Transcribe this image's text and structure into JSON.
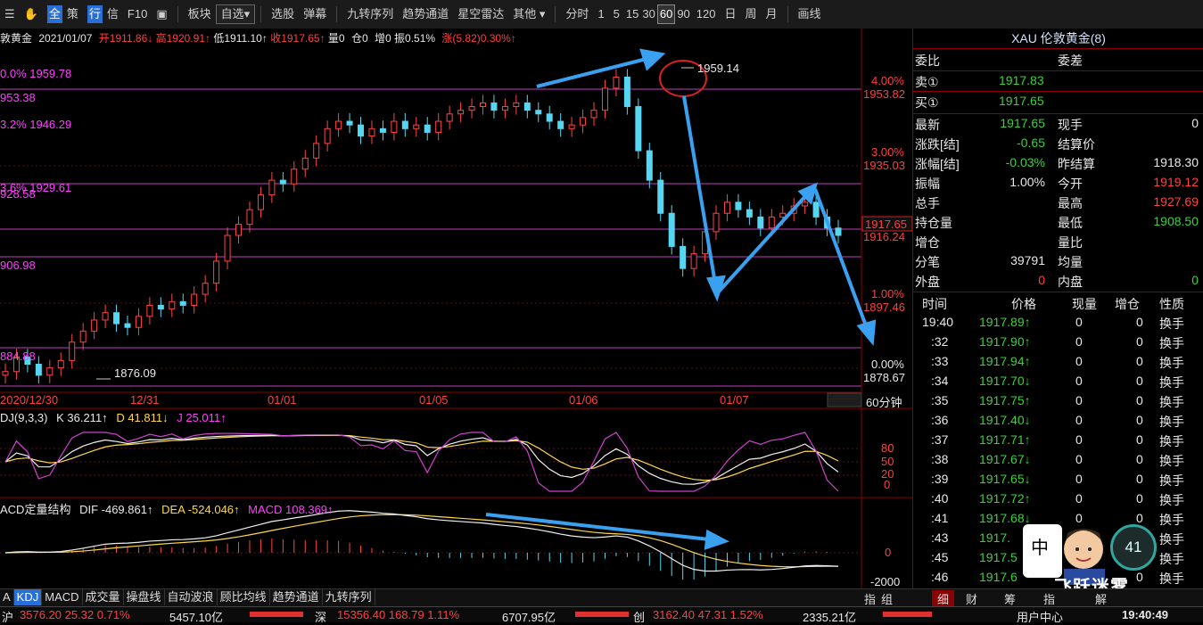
{
  "toolbar": {
    "items": [
      "板块",
      "自选",
      "选股",
      "弹幕",
      "九转序列",
      "趋势通道",
      "星空雷达",
      "其他"
    ],
    "icons_left": [
      "全",
      "策",
      "行",
      "信",
      "F10"
    ],
    "periods": [
      "分时",
      "1",
      "5",
      "15",
      "30",
      "60",
      "90",
      "120",
      "日",
      "周",
      "月"
    ],
    "active_period": "60",
    "draw_label": "画线"
  },
  "info": {
    "symbol": "敦黄金",
    "date": "2021/01/07",
    "open": "开1911.86↓",
    "high": "高1920.91↑",
    "low": "低1911.10↑",
    "close": "收1917.65↑",
    "vol": "量0",
    "pos": "仓0",
    "add": "增0",
    "amp": "振0.51%",
    "chg": "涨(5.82)0.30%↑"
  },
  "chart_data": {
    "type": "candlestick",
    "period": "60分钟",
    "price_axis": [
      "4.00%",
      "1953.82",
      "3.00%",
      "1935.03",
      "1917.65",
      "1916.24",
      "1.00%",
      "1897.46",
      "0.00%",
      "1878.67"
    ],
    "fib_labels": [
      "0.0% 1959.78",
      "953.38",
      "3.2% 1946.29",
      "3.6% 1929.61",
      "928.58",
      "906.98",
      "884.88"
    ],
    "annotations": [
      "1959.14",
      "1876.09"
    ],
    "date_labels": [
      "2020/12/30",
      "12/31",
      "01/01",
      "01/05",
      "01/06",
      "01/07"
    ],
    "kdj": {
      "label": "DJ(9,3,3)",
      "K": "K 36.211↑",
      "D": "D 41.811↓",
      "J": "J 25.011↑",
      "axis": [
        "80",
        "50",
        "20",
        "0"
      ]
    },
    "macd": {
      "label": "ACD定量结构",
      "DIF": "DIF -469.861↑",
      "DEA": "DEA -524.046↑",
      "MACD": "MACD 108.369↑",
      "axis": [
        "0",
        "-2000"
      ]
    },
    "closes": [
      1878,
      1882,
      1880,
      1877,
      1879,
      1881,
      1886,
      1889,
      1892,
      1894,
      1891,
      1890,
      1893,
      1896,
      1895,
      1897,
      1896,
      1899,
      1902,
      1908,
      1915,
      1918,
      1922,
      1926,
      1930,
      1929,
      1933,
      1936,
      1940,
      1944,
      1946,
      1945,
      1942,
      1944,
      1943,
      1946,
      1944,
      1945,
      1943,
      1946,
      1948,
      1949,
      1950,
      1951,
      1949,
      1950,
      1951,
      1949,
      1948,
      1946,
      1944,
      1945,
      1947,
      1949,
      1955,
      1958,
      1950,
      1938,
      1930,
      1921,
      1912,
      1906,
      1910,
      1916,
      1921,
      1924,
      1922,
      1920,
      1917,
      1920,
      1921,
      1923,
      1924,
      1920,
      1917,
      1915
    ]
  },
  "rightpanel": {
    "title": "XAU 伦敦黄金(8)",
    "weibi": "委比",
    "weicha": "委差",
    "sell_label": "卖①",
    "sell_price": "1917.83",
    "buy_label": "买①",
    "buy_price": "1917.65",
    "rows_left": [
      [
        "最新",
        "1917.65"
      ],
      [
        "涨跌[结]",
        "-0.65"
      ],
      [
        "涨幅[结]",
        "-0.03%"
      ],
      [
        "振幅",
        "1.00%"
      ],
      [
        "总手",
        ""
      ],
      [
        "持仓量",
        ""
      ],
      [
        "增仓",
        ""
      ],
      [
        "分笔",
        "39791"
      ],
      [
        "外盘",
        "0"
      ]
    ],
    "rows_right": [
      [
        "现手",
        "0"
      ],
      [
        "结算价",
        ""
      ],
      [
        "昨结算",
        "1918.30"
      ],
      [
        "今开",
        "1919.12"
      ],
      [
        "最高",
        "1927.69"
      ],
      [
        "最低",
        "1908.50"
      ],
      [
        "量比",
        ""
      ],
      [
        "均量",
        ""
      ],
      [
        "内盘",
        "0"
      ]
    ],
    "tick_headers": [
      "时间",
      "价格",
      "现量",
      "增仓",
      "性质"
    ],
    "ticks": [
      [
        "19:40",
        "1917.89↑",
        "0",
        "0",
        "换手"
      ],
      [
        ":32",
        "1917.90↑",
        "0",
        "0",
        "换手"
      ],
      [
        ":33",
        "1917.94↑",
        "0",
        "0",
        "换手"
      ],
      [
        ":34",
        "1917.70↓",
        "0",
        "0",
        "换手"
      ],
      [
        ":35",
        "1917.75↑",
        "0",
        "0",
        "换手"
      ],
      [
        ":36",
        "1917.40↓",
        "0",
        "0",
        "换手"
      ],
      [
        ":37",
        "1917.71↑",
        "0",
        "0",
        "换手"
      ],
      [
        ":38",
        "1917.67↓",
        "0",
        "0",
        "换手"
      ],
      [
        ":39",
        "1917.65↓",
        "0",
        "0",
        "换手"
      ],
      [
        ":40",
        "1917.72↑",
        "0",
        "0",
        "换手"
      ],
      [
        ":41",
        "1917.68↓",
        "0",
        "0",
        "换手"
      ],
      [
        ":43",
        "1917.",
        "0",
        "0",
        "换手"
      ],
      [
        ":45",
        "1917.5",
        "0",
        "0",
        "换手"
      ],
      [
        ":46",
        "1917.6",
        "0",
        "0",
        "换手"
      ]
    ]
  },
  "bottomtabs": [
    "A",
    "KDJ",
    "MACD",
    "成交量",
    "操盘线",
    "自动波浪",
    "顾比均线",
    "趋势通道",
    "九转序列"
  ],
  "bottom_right": [
    "指",
    "组",
    "细",
    "财",
    "筹",
    "指",
    "解"
  ],
  "statusbar": {
    "sh_label": "沪",
    "sh": "3576.20  25.32  0.71%",
    "sh_amt": "5457.10亿",
    "sz_label": "深",
    "sz": "15356.40  168.79  1.11%",
    "sz_amt": "6707.95亿",
    "cy_label": "创",
    "cy": "3162.40  47.31  1.52%",
    "cy_amt": "2335.21亿",
    "usercenter": "用户中心",
    "clock": "19:40:49"
  },
  "overlay": {
    "zhong": "中",
    "gauge": "41",
    "watermark": "飞跃迷雾"
  }
}
